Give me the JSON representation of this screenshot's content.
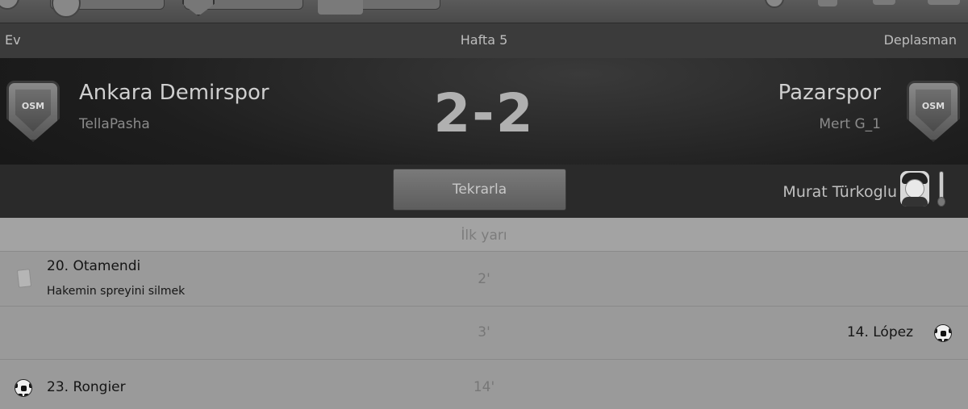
{
  "weekbar": {
    "home_label": "Ev",
    "week_label": "Hafta 5",
    "away_label": "Deplasman"
  },
  "match": {
    "home_team": "Ankara Demirspor",
    "home_manager": "TellaPasha",
    "away_team": "Pazarspor",
    "away_manager": "Mert G_1",
    "score": "2-2",
    "crest_text": "OSM",
    "replay_label": "Tekrarla",
    "referee": "Murat Türkoglu"
  },
  "half_label": "İlk yarı",
  "events": [
    {
      "minute": "2'",
      "side": "home",
      "type": "card",
      "player": "20. Otamendi",
      "detail": "Hakemin spreyini silmek"
    },
    {
      "minute": "3'",
      "side": "away",
      "type": "goal",
      "player": "14. López",
      "detail": ""
    },
    {
      "minute": "14'",
      "side": "home",
      "type": "goal",
      "player": "23. Rongier",
      "detail": ""
    }
  ]
}
